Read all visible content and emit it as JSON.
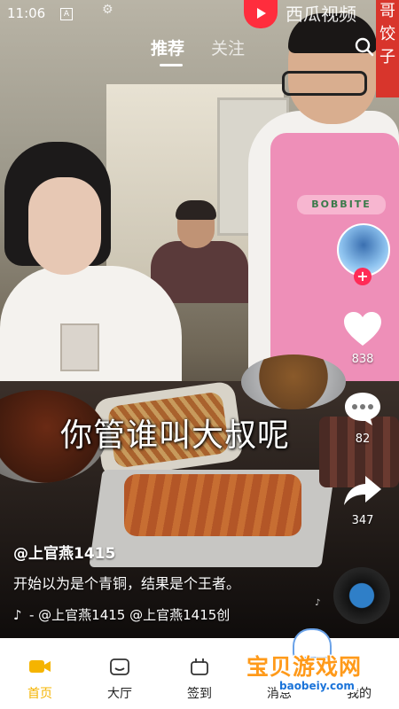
{
  "status_bar": {
    "time": "11:06",
    "a_badge": "A"
  },
  "brand": {
    "name": "西瓜视频",
    "side_text": "哥 饺子"
  },
  "tabs": [
    {
      "label": "推荐"
    },
    {
      "label": "关注"
    }
  ],
  "video": {
    "overlay_caption": "你管谁叫大叔呢",
    "apron_text": "BOBBITE",
    "author": "@上官燕1415",
    "description": "开始以为是个青铜，结果是个王者。",
    "music_text": "- @上官燕1415 @上官燕1415创"
  },
  "actions": {
    "likes": "838",
    "comments": "82",
    "shares": "347"
  },
  "icons": {
    "search": "search-icon",
    "heart": "heart-icon",
    "comment": "comment-icon",
    "share": "share-icon",
    "tiktok": "tiktok-note-icon"
  },
  "bottom_nav": [
    {
      "label": "首页",
      "active": true
    },
    {
      "label": "大厅"
    },
    {
      "label": "签到"
    },
    {
      "label": "消息"
    },
    {
      "label": "我的"
    }
  ],
  "watermark": {
    "title": "宝贝游戏网",
    "url": "baobeiy.com"
  },
  "colors": {
    "accent": "#f5b400",
    "follow": "#ff2b57",
    "brand_red": "#ff2d3d"
  }
}
